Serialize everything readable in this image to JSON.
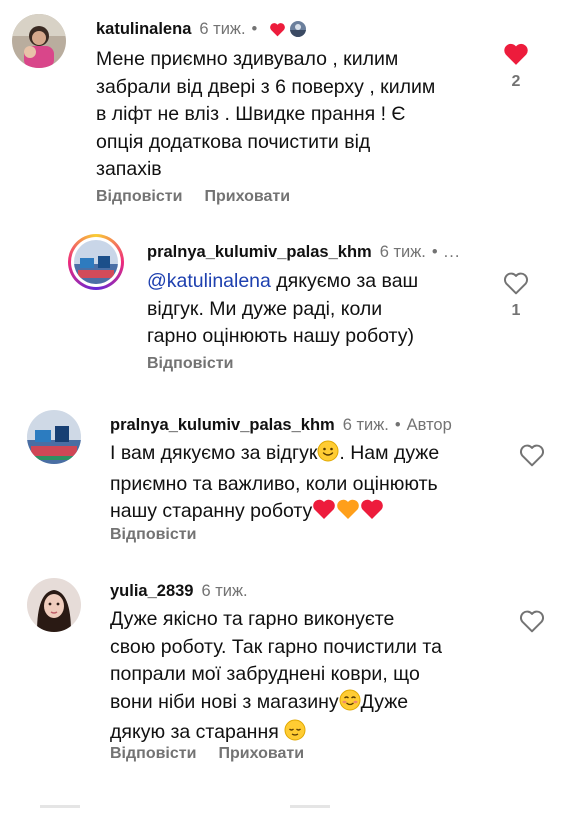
{
  "comments": [
    {
      "user": "katulinalena",
      "time": "6 тиж.",
      "dot": "•",
      "lines": [
        "Мене приємно здивувало , килим",
        "забрали від двері з 6 поверху , килим",
        "в ліфт не вліз . Швидке прання ! Є",
        "опція додаткова  почистити від",
        "запахів"
      ],
      "reply_label": "Відповісти",
      "hide_label": "Приховати",
      "like_count": "2",
      "liked": true
    },
    {
      "user": "pralnya_kulumiv_palas_khm",
      "time": "6 тиж.",
      "dot": "•",
      "more": "...",
      "mention": "@katulinalena",
      "line1_rest": " дякуємо за ваш",
      "lines": [
        "відгук. Ми дуже раді, коли",
        "гарно оцінюють нашу роботу)"
      ],
      "reply_label": "Відповісти",
      "like_count": "1",
      "liked": false
    },
    {
      "user": "pralnya_kulumiv_palas_khm",
      "time": "6 тиж.",
      "dot": "•",
      "author": "Автор",
      "line1": "І вам дякуємо за відгук",
      "line1_rest": ". Нам дуже",
      "line2": "приємно та важливо, коли оцінюють",
      "line3": "нашу старанну роботу",
      "reply_label": "Відповісти",
      "liked": false
    },
    {
      "user": "yulia_2839",
      "time": "6 тиж.",
      "lines": [
        "Дуже якісно та гарно виконуєте",
        "свою роботу. Так гарно почистили та",
        "попрали мої забруднені коври, що"
      ],
      "line4": "вони ніби нові з магазину",
      "line4_rest": "Дуже",
      "line5": "дякую за старання ",
      "reply_label": "Відповісти",
      "hide_label": "Приховати",
      "liked": false
    }
  ],
  "colors": {
    "liked_heart": "#ed1c3c",
    "secondary_text": "#737373",
    "mention": "#1e40af"
  }
}
